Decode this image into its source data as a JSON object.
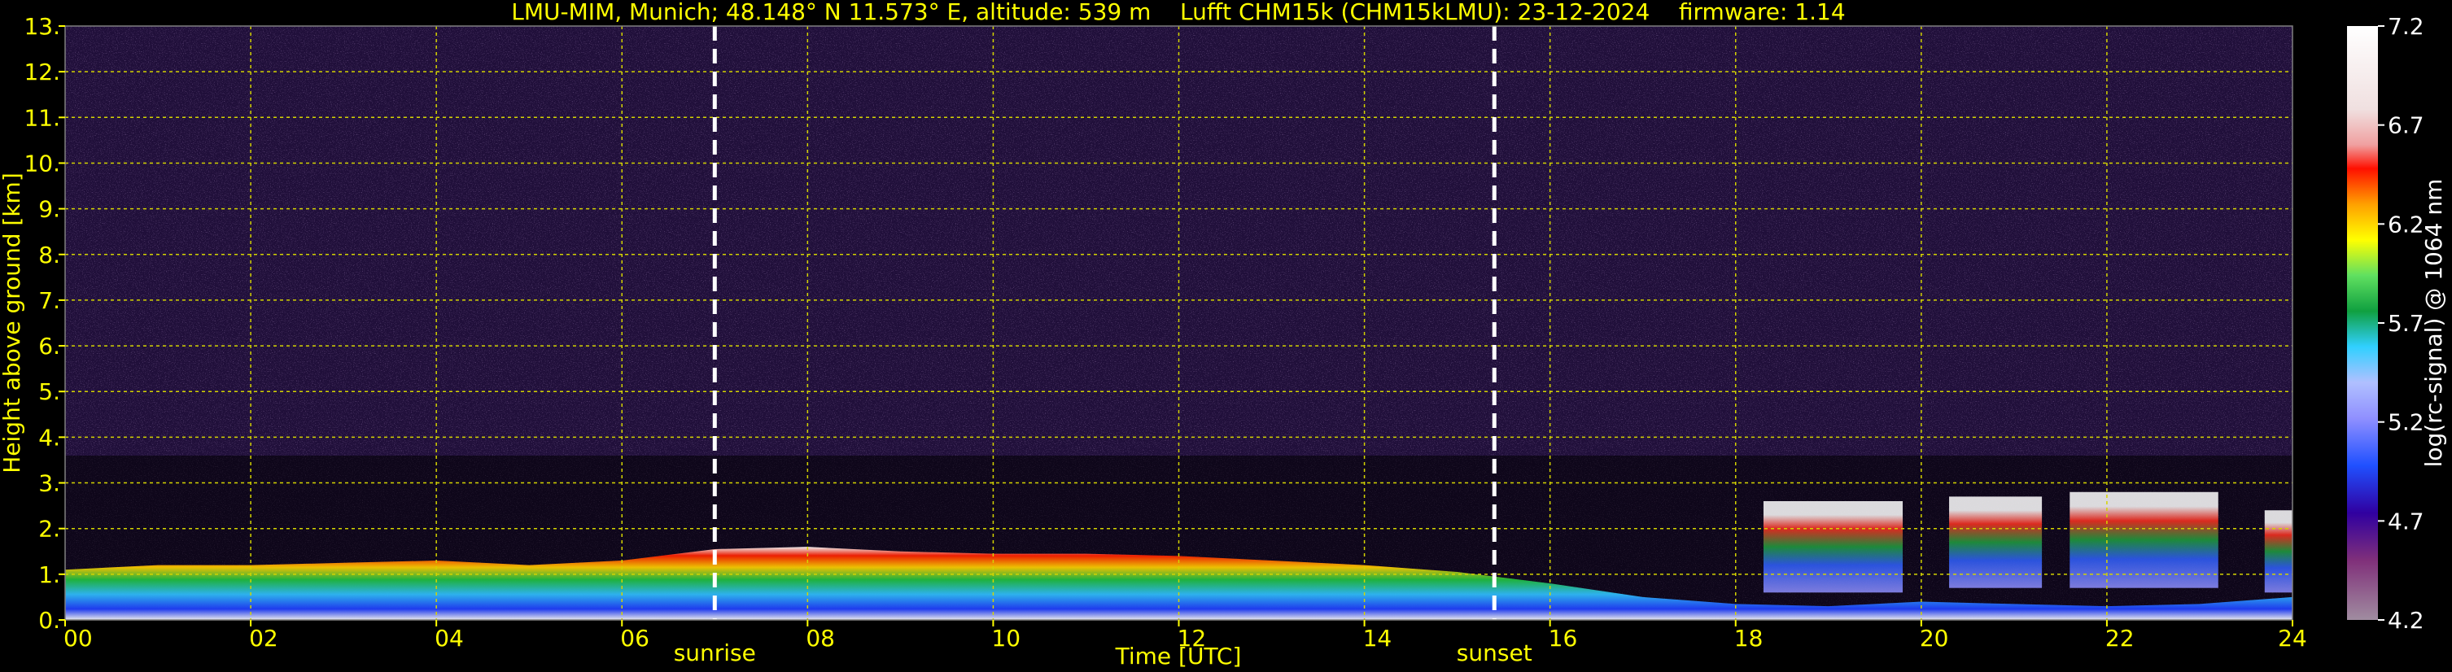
{
  "chart_data": {
    "type": "heatmap",
    "title": "LMU-MIM, Munich; 48.148° N 11.573° E, altitude: 539 m    Lufft CHM15k (CHM15kLMU): 23-12-2024    firmware: 1.14",
    "xlabel": "Time [UTC]",
    "ylabel": "Height above ground [km]",
    "xlim": [
      0,
      24
    ],
    "ylim": [
      0,
      13
    ],
    "x_ticks": [
      "00",
      "02",
      "04",
      "06",
      "08",
      "10",
      "12",
      "14",
      "16",
      "18",
      "20",
      "22",
      "24"
    ],
    "y_ticks": [
      "0.",
      "1.",
      "2.",
      "3.",
      "4.",
      "5.",
      "6.",
      "7.",
      "8.",
      "9.",
      "10.",
      "11.",
      "12.",
      "13."
    ],
    "grid": true,
    "markers": [
      {
        "label": "sunrise",
        "x": 7.0
      },
      {
        "label": "sunset",
        "x": 15.4
      }
    ],
    "colorbar": {
      "label": "log(rc-signal) @ 1064 nm",
      "range": [
        4.2,
        7.2
      ],
      "ticks": [
        "7.2",
        "6.7",
        "6.2",
        "5.7",
        "5.2",
        "4.7",
        "4.2"
      ]
    },
    "boundary_layer_top_km": {
      "x": [
        0,
        1,
        2,
        3,
        4,
        5,
        6,
        7,
        8,
        9,
        10,
        11,
        12,
        13,
        14,
        15,
        16,
        17,
        18,
        19,
        20,
        21,
        22,
        23,
        24
      ],
      "y": [
        1.1,
        1.2,
        1.2,
        1.25,
        1.3,
        1.2,
        1.3,
        1.55,
        1.6,
        1.5,
        1.45,
        1.45,
        1.4,
        1.3,
        1.2,
        1.05,
        0.8,
        0.5,
        0.35,
        0.3,
        0.4,
        0.35,
        0.3,
        0.35,
        0.5
      ]
    },
    "upper_cloud_segments": [
      {
        "start": 18.3,
        "end": 19.8,
        "base_km": 0.6,
        "top_km": 2.6
      },
      {
        "start": 20.3,
        "end": 21.3,
        "base_km": 0.7,
        "top_km": 2.7
      },
      {
        "start": 21.6,
        "end": 23.2,
        "base_km": 0.7,
        "top_km": 2.8
      },
      {
        "start": 23.7,
        "end": 24.0,
        "base_km": 0.6,
        "top_km": 2.4
      }
    ]
  }
}
